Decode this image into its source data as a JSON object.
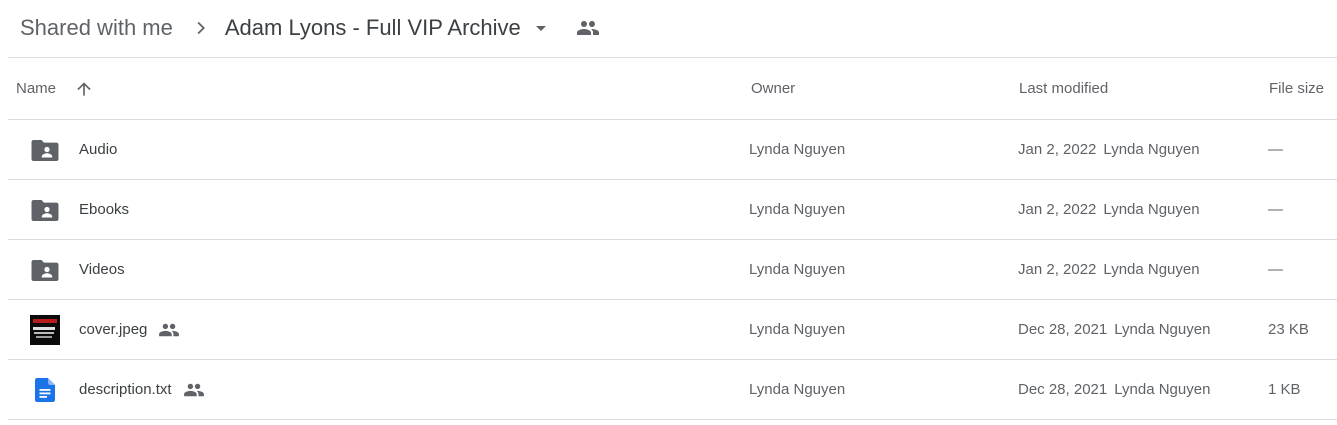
{
  "breadcrumb": {
    "root": "Shared with me",
    "current": "Adam Lyons - Full VIP Archive"
  },
  "table": {
    "columns": {
      "name": "Name",
      "owner": "Owner",
      "last_modified": "Last modified",
      "file_size": "File size"
    },
    "sort": {
      "column": "name",
      "direction": "ascending",
      "icon": "arrow-up-icon"
    },
    "rows": [
      {
        "name": "Audio",
        "type": "shared-folder",
        "icon": "shared-folder-icon",
        "owner": "Lynda Nguyen",
        "modified_date": "Jan 2, 2022",
        "modified_by": "Lynda Nguyen",
        "size": "—",
        "shared": false
      },
      {
        "name": "Ebooks",
        "type": "shared-folder",
        "icon": "shared-folder-icon",
        "owner": "Lynda Nguyen",
        "modified_date": "Jan 2, 2022",
        "modified_by": "Lynda Nguyen",
        "size": "—",
        "shared": false
      },
      {
        "name": "Videos",
        "type": "shared-folder",
        "icon": "shared-folder-icon",
        "owner": "Lynda Nguyen",
        "modified_date": "Jan 2, 2022",
        "modified_by": "Lynda Nguyen",
        "size": "—",
        "shared": false
      },
      {
        "name": "cover.jpeg",
        "type": "image",
        "icon": "image-thumbnail",
        "owner": "Lynda Nguyen",
        "modified_date": "Dec 28, 2021",
        "modified_by": "Lynda Nguyen",
        "size": "23 KB",
        "shared": true
      },
      {
        "name": "description.txt",
        "type": "document",
        "icon": "docs-icon",
        "owner": "Lynda Nguyen",
        "modified_date": "Dec 28, 2021",
        "modified_by": "Lynda Nguyen",
        "size": "1 KB",
        "shared": true
      }
    ]
  },
  "colors": {
    "text_primary": "#3c4043",
    "text_secondary": "#5f6368",
    "divider": "#dadce0",
    "folder_icon": "#5f6368",
    "docs_blue": "#1a73e8"
  }
}
